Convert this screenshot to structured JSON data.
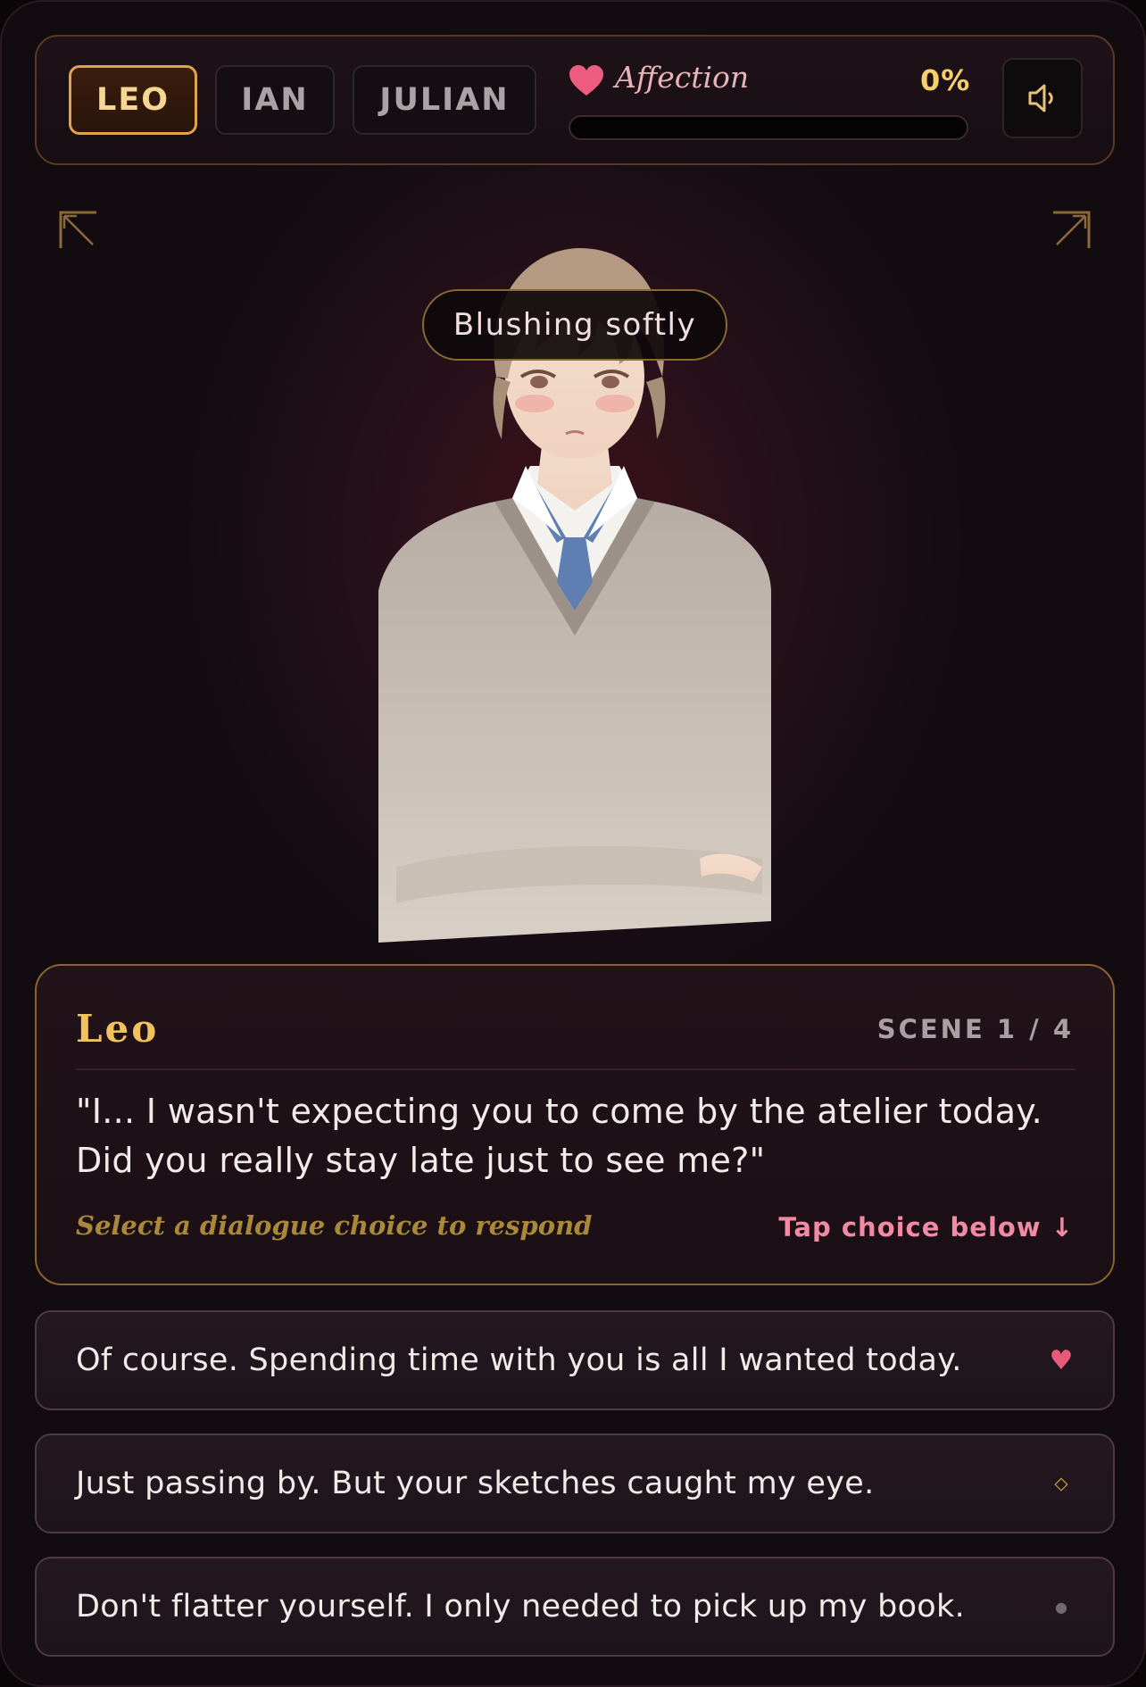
{
  "header": {
    "tabs": [
      {
        "label": "LEO",
        "active": true
      },
      {
        "label": "IAN",
        "active": false
      },
      {
        "label": "JULIAN",
        "active": false
      }
    ],
    "affection": {
      "label": "Affection",
      "percent_text": "0%",
      "value": 0,
      "icon": "heart-icon"
    },
    "sound": {
      "icon": "speaker-icon"
    }
  },
  "scene": {
    "mood": "Blushing softly",
    "portrait": "character-portrait"
  },
  "dialogue": {
    "speaker": "Leo",
    "scene_label": "SCENE 1 / 4",
    "text": "\"I... I wasn't expecting you to come by the atelier today. Did you really stay late just to see me?\"",
    "hint": "Select a dialogue choice to respond",
    "tap_hint": "Tap choice below ↓"
  },
  "choices": [
    {
      "text": "Of course. Spending time with you is all I wanted today.",
      "icon": "♥",
      "icon_name": "heart-icon",
      "color": "#e85a7a"
    },
    {
      "text": "Just passing by. But your sketches caught my eye.",
      "icon": "⬦",
      "icon_name": "diamond-icon",
      "color": "#d8a53c"
    },
    {
      "text": "Don't flatter yourself. I only needed to pick up my book.",
      "icon": "●",
      "icon_name": "dot-icon",
      "color": "#6f6a6c"
    }
  ],
  "colors": {
    "accent_gold": "#f0c25e",
    "accent_pink": "#f28aa5",
    "background": "#170d14"
  }
}
